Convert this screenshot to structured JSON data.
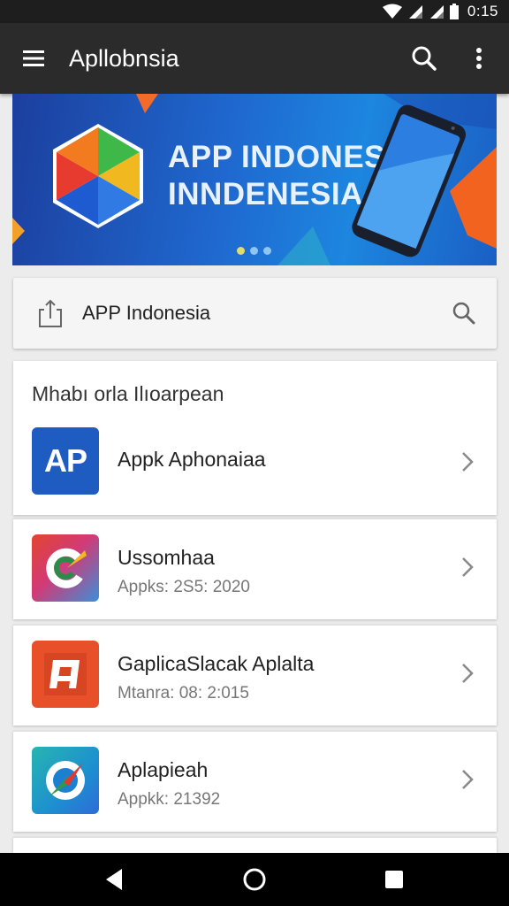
{
  "status_bar": {
    "time": "0:15",
    "icons": [
      "wifi-icon",
      "signal-icon",
      "signal-icon",
      "battery-icon"
    ]
  },
  "app_bar": {
    "title": "Apllobnsia",
    "icons": [
      "menu-icon",
      "search-icon",
      "more-vert-icon"
    ]
  },
  "banner": {
    "title_line1": "APP INDONESIA",
    "title_line2": "INNDENESIA",
    "slide_count": 3,
    "active_slide": 1
  },
  "search_card": {
    "query": "APP Indonesia",
    "icons": [
      "share-icon",
      "search-icon"
    ]
  },
  "list": {
    "section_title": "Mhabı orla Ilıoarpean",
    "items": [
      {
        "title": "Appk Aphonaiaa",
        "subtitle": "",
        "icon_text": "AP",
        "icon_name": "ap-app-icon"
      },
      {
        "title": "Ussomhaa",
        "subtitle": "Appks: 2S5: 2020",
        "icon_name": "colorful-c-app-icon"
      },
      {
        "title": "GaplicaSlacak Aplalta",
        "subtitle": "Mtanra: 08: 2:015",
        "icon_name": "orange-square-app-icon"
      },
      {
        "title": "Aplapieah",
        "subtitle": "Appkk: 21392",
        "icon_name": "compass-app-icon"
      }
    ]
  },
  "nav_bar": {
    "buttons": [
      "back-icon",
      "home-icon",
      "recents-icon"
    ]
  },
  "colors": {
    "app_bar": "#2b2b2b",
    "status_bar": "#1e1e1e",
    "banner_blue": "#1f69d0",
    "background": "#ececec"
  }
}
